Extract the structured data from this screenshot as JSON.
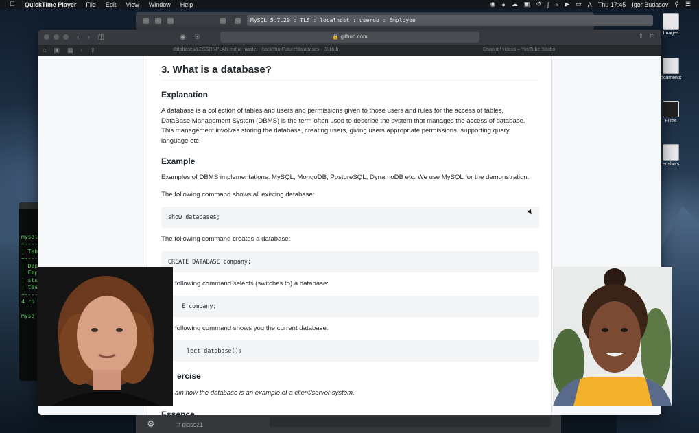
{
  "menubar": {
    "app_name": "QuickTime Player",
    "items": [
      "File",
      "Edit",
      "View",
      "Window",
      "Help"
    ],
    "clock": "Thu 17:45",
    "user": "Igor Budasov"
  },
  "terminal_window": {
    "title": "MySQL 5.7.20 : TLS : localhost : userdb : Employee",
    "lines": [
      "mysql",
      "+----",
      "| Tab",
      "+----",
      "| Dep",
      "| Emp",
      "| stu",
      "| tea",
      "+----",
      "4 ro",
      "",
      "mysq"
    ]
  },
  "desktop_icons": [
    "Images",
    "ocuments",
    "Films",
    "enshots"
  ],
  "browser": {
    "url": "github.com",
    "tab_left": "databases/LESSONPLAN.md at master · hackYourFuture/databases · GitHub",
    "tab_right": "Channel videos – YouTube Studio"
  },
  "article": {
    "heading": "3. What is a database?",
    "explanation_heading": "Explanation",
    "explanation_lines": [
      "A database is a collection of tables and users and permissions given to those users and rules for the access of tables.",
      "DataBase Management System (DBMS) is the term often used to describe the system that manages the access of database.",
      "This management involves storing the database, creating users, giving users appropriate permissions, supporting query",
      "language etc."
    ],
    "example_heading": "Example",
    "example_text": "Examples of DBMS implementations: MySQL, MongoDB, PostgreSQL, DynamoDB etc. We use MySQL for the demonstration.",
    "cmd1_text": "The following command shows all existing database:",
    "cmd1_code": "show databases;",
    "cmd2_text": "The following command creates a database:",
    "cmd2_code": "CREATE DATABASE company;",
    "cmd3_text": "following command selects (switches to) a database:",
    "cmd3_code": "E company;",
    "cmd4_text": "following command shows you the current database:",
    "cmd4_code": "lect database();",
    "exercise_heading": "ercise",
    "exercise_text": "ain how the database is an example of a client/server system.",
    "essence_heading": "Essence"
  },
  "bottom_bar": {
    "channel": "# class21"
  },
  "colors": {
    "page_bg": "#ffffff",
    "code_bg": "#f3f4f6",
    "text": "#24292e",
    "terminal_green": "#6fdc6f"
  }
}
